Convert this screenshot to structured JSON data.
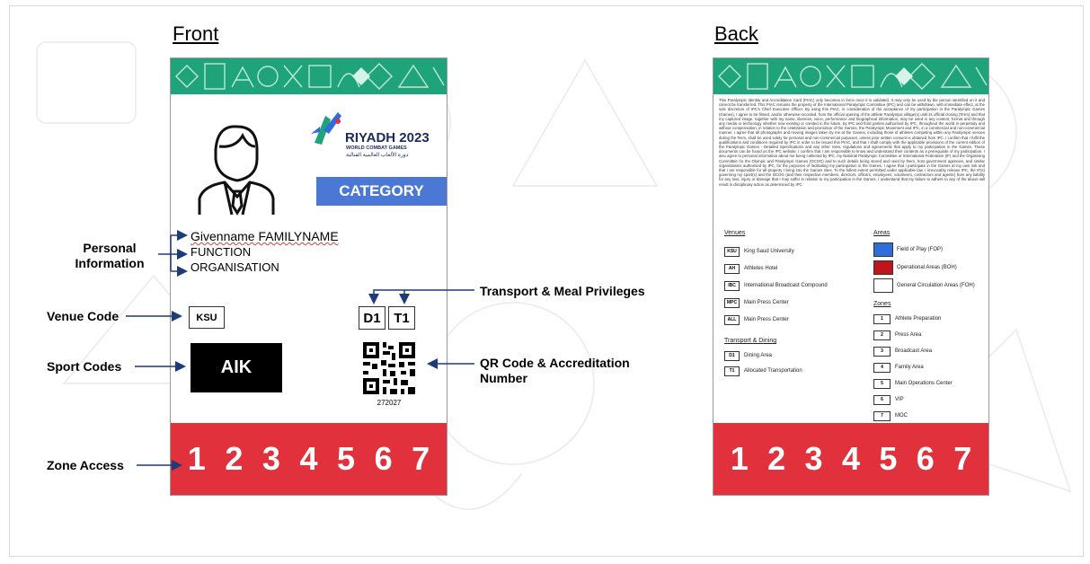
{
  "front": {
    "heading": "Front",
    "logo_title": "RIYADH 2023",
    "logo_subtitle": "WORLD COMBAT GAMES",
    "logo_arabic": "دورة الألعاب العالمية القتالية",
    "category": "CATEGORY",
    "name": "Givenname FAMILYNAME",
    "function": "FUNCTION",
    "organisation": "ORGANISATION",
    "venue_code": "KSU",
    "privilege_1": "D1",
    "privilege_2": "T1",
    "sport_code": "AIK",
    "accreditation_number": "272027",
    "zones": [
      "1",
      "2",
      "3",
      "4",
      "5",
      "6",
      "7"
    ]
  },
  "callouts": {
    "personal_info": "Personal Information",
    "venue_code": "Venue Code",
    "sport_codes": "Sport Codes",
    "zone_access": "Zone Access",
    "transport_meal": "Transport & Meal Privileges",
    "qr_code": "QR Code & Accreditation Number"
  },
  "back": {
    "heading": "Back",
    "legal_text": "This Paralympic Identity and Accreditation Card (PIAC) only becomes in force once it is validated. It may only be used by the person identified on it and cannot be transferred. This PIAC remains the property of the International Paralympic Committee (IPC) and can be withdrawn, with immediate effect, at the sole discretion of IPC's Chief Executive Officer. By using this PIAC, in consideration of the acceptance of my participation in the Paralympic Games (Games), I agree to be filmed, and/or otherwise recorded, from the official opening of the athlete Paralympic village(s) until its official closing (Term) and that my captured image, together with my name, likeness, voice, performance and biographical information, may be used in any content, format and through any media or technology whether now existing or created in the future, by IPC and third parties authorised by IPC, throughout the world in perpetuity and without compensation, in relation to the celebration and promotion of the Games, the Paralympic Movement and IPC, in a commercial and non-commercial manner. I agree that all photographs and moving images taken by me at the Games, including those of athletes competing within any Paralympic venues during the Term, shall be used solely for personal and non-commercial purposes, unless prior written consent is obtained from IPC. I confirm that I fulfil the qualifications and conditions required by IPC in order to be issued this PIAC, and that I shall comply with the applicable provisions of the current edition of the Paralympic Games - Detailed Specifications and any other rules, regulations and agreements that apply to my participation in the Games. These documents can be found on the IPC website. I confirm that I am responsible to know and understand their contents as a prerequisite of my participation. I also agree to personal information about me being collected by IPC, my National Paralympic Committee or International Federation (IF) and the Organising Committee for the Olympic and Paralympic Games (OCOG) and to such details being stored and used by them, host government agencies, and similar organisations authorised by IPC, for the purposes of facilitating my participation in the Games. I agree that I participate in the Games at my own risk and that I am responsible for all property I bring into the Games sites. To the fullest extent permitted under applicable law, I irrevocably release IPC, the IF(s) governing my sport(s) and the OCOG (and their respective members, directors, officers, employees, volunteers, contractors and agents) from any liability for any loss, injury or damage that I may suffer in relation to my participation in the Games. I understand that my failure to adhere to any of the above will result in disciplinary action as determined by IPC.",
    "venues_heading": "Venues",
    "venues": [
      {
        "code": "KSU",
        "label": "King Saud University"
      },
      {
        "code": "AH",
        "label": "Athletes Hotel"
      },
      {
        "code": "IBC",
        "label": "International Broadcast Compound"
      },
      {
        "code": "MPC",
        "label": "Main Press Center"
      },
      {
        "code": "ALL",
        "label": "Main Press Center"
      }
    ],
    "areas_heading": "Areas",
    "areas": [
      {
        "color": "#2f6ddb",
        "label": "Field of Play (FOP)"
      },
      {
        "color": "#c0151c",
        "label": "Operational Areas (BOH)"
      },
      {
        "color": "#ffffff",
        "label": "General Circulation Areas (FOH)"
      }
    ],
    "transport_heading": "Transport & Dining",
    "transport": [
      {
        "code": "D1",
        "label": "Dining Area"
      },
      {
        "code": "T1",
        "label": "Allocated Transportation"
      }
    ],
    "zones_heading": "Zones",
    "zone_list": [
      {
        "code": "1",
        "label": "Athlete Preparation"
      },
      {
        "code": "2",
        "label": "Press Area"
      },
      {
        "code": "3",
        "label": "Broadcast Area"
      },
      {
        "code": "4",
        "label": "Family Area"
      },
      {
        "code": "5",
        "label": "Main Operations Center"
      },
      {
        "code": "6",
        "label": "VIP"
      },
      {
        "code": "7",
        "label": "MOC"
      }
    ],
    "zones": [
      "1",
      "2",
      "3",
      "4",
      "5",
      "6",
      "7"
    ]
  },
  "colors": {
    "banner": "#1fa37a",
    "category": "#4a78d4",
    "zone_bar": "#e0313d"
  }
}
